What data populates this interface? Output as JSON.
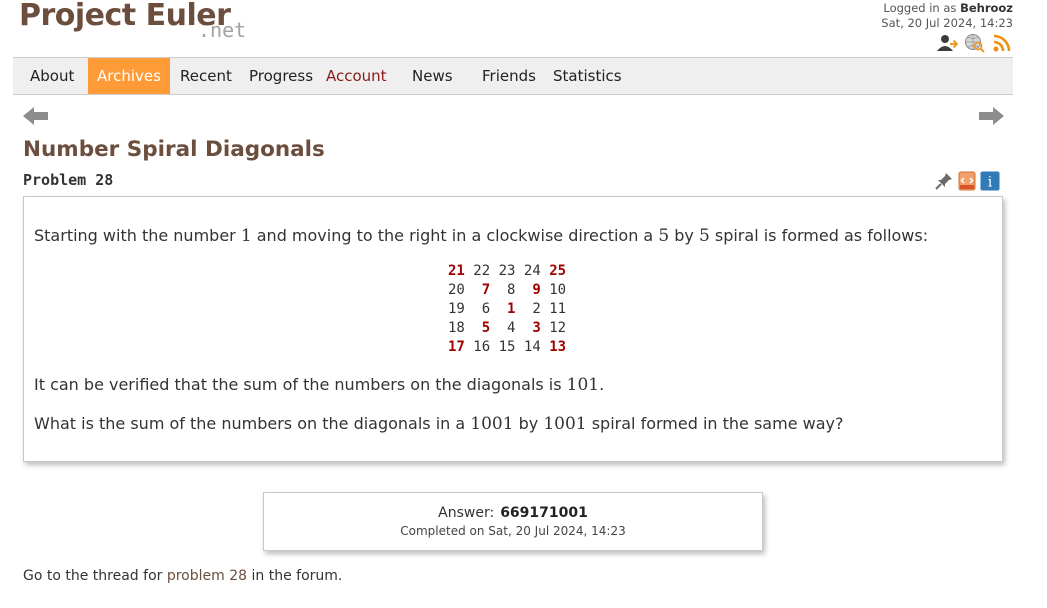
{
  "logo": {
    "main": "Project Euler",
    "suffix": ".net"
  },
  "login": {
    "prefix": "Logged in as",
    "user": "Behrooz",
    "datetime": "Sat, 20 Jul 2024, 14:23"
  },
  "header_icons": [
    "account-icon",
    "globe-search-icon",
    "rss-feed-icon"
  ],
  "nav": [
    {
      "label": "About"
    },
    {
      "label": "Archives",
      "active": true
    },
    {
      "label": "Recent"
    },
    {
      "label": "Progress"
    },
    {
      "label": "Account"
    },
    {
      "label": "News"
    },
    {
      "label": "Friends"
    },
    {
      "label": "Statistics"
    }
  ],
  "problem": {
    "title": "Number Spiral Diagonals",
    "number_label": "Problem 28",
    "para1": {
      "a": "Starting with the number ",
      "n1": "1",
      "b": " and moving to the right in a clockwise direction a ",
      "n2": "5",
      "c": " by ",
      "n3": "5",
      "d": " spiral is formed as follows:"
    },
    "spiral": [
      [
        "21",
        "22",
        "23",
        "24",
        "25"
      ],
      [
        "20",
        "7",
        "8",
        "9",
        "10"
      ],
      [
        "19",
        "6",
        "1",
        "2",
        "11"
      ],
      [
        "18",
        "5",
        "4",
        "3",
        "12"
      ],
      [
        "17",
        "16",
        "15",
        "14",
        "13"
      ]
    ],
    "para2": {
      "a": "It can be verified that the sum of the numbers on the diagonals is ",
      "n1": "101",
      "b": "."
    },
    "para3": {
      "a": "What is the sum of the numbers on the diagonals in a ",
      "n1": "1001",
      "b": " by ",
      "n2": "1001",
      "c": " spiral formed in the same way?"
    }
  },
  "answer": {
    "label": "Answer:",
    "value": "669171001",
    "completed": "Completed on Sat, 20 Jul 2024, 14:23"
  },
  "forum": {
    "a": "Go to the thread for ",
    "link": "problem 28",
    "b": " in the forum."
  },
  "colors": {
    "brown": "#6b4e3d",
    "active_tab": "#ff9b36",
    "diagonal": "#a00000",
    "info_blue": "#2f7ab7"
  }
}
